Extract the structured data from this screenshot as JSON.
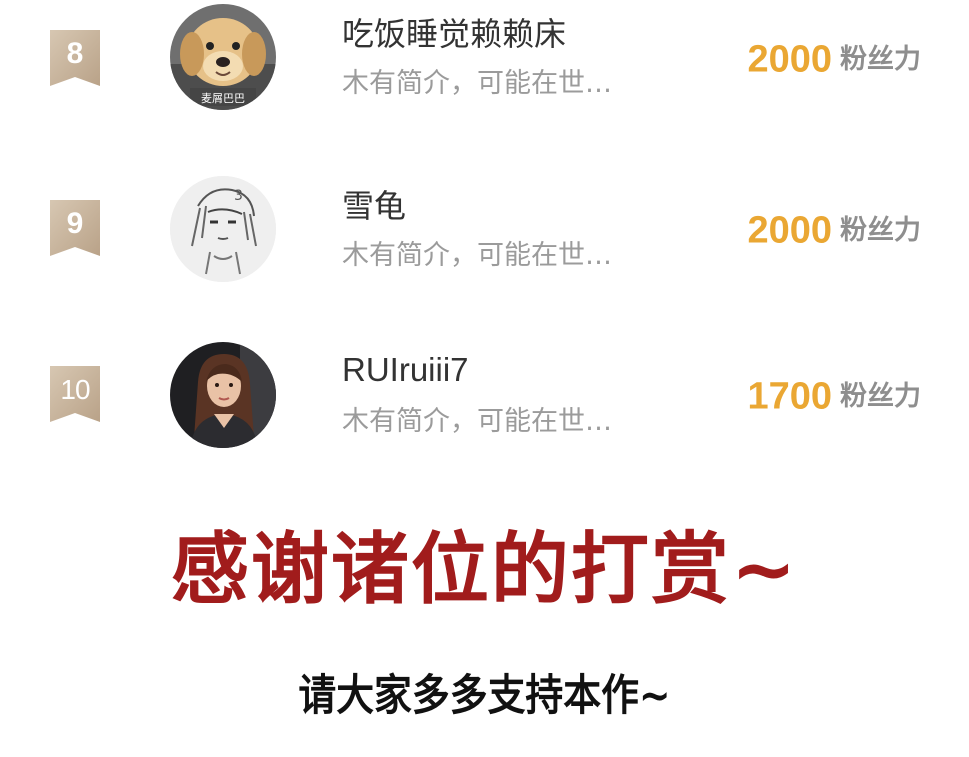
{
  "colors": {
    "badge": "#c8b6a0",
    "fans_number": "#eaa733",
    "thanks_text": "#a11c1c"
  },
  "leaderboard": {
    "rows": [
      {
        "rank": "8",
        "name": "吃饭睡觉赖赖床",
        "bio": "木有简介，可能在世…",
        "fans_value": "2000",
        "fans_unit": "粉丝力",
        "avatar_icon": "puppy-avatar",
        "avatar_caption": "麦屑巴巴"
      },
      {
        "rank": "9",
        "name": "雪龟",
        "bio": "木有简介，可能在世…",
        "fans_value": "2000",
        "fans_unit": "粉丝力",
        "avatar_icon": "sketch-avatar"
      },
      {
        "rank": "10",
        "name": "RUIruiii7",
        "bio": "木有简介，可能在世…",
        "fans_value": "1700",
        "fans_unit": "粉丝力",
        "avatar_icon": "portrait-avatar"
      }
    ]
  },
  "footer": {
    "thanks": "感谢诸位的打赏~",
    "support": "请大家多多支持本作~"
  }
}
